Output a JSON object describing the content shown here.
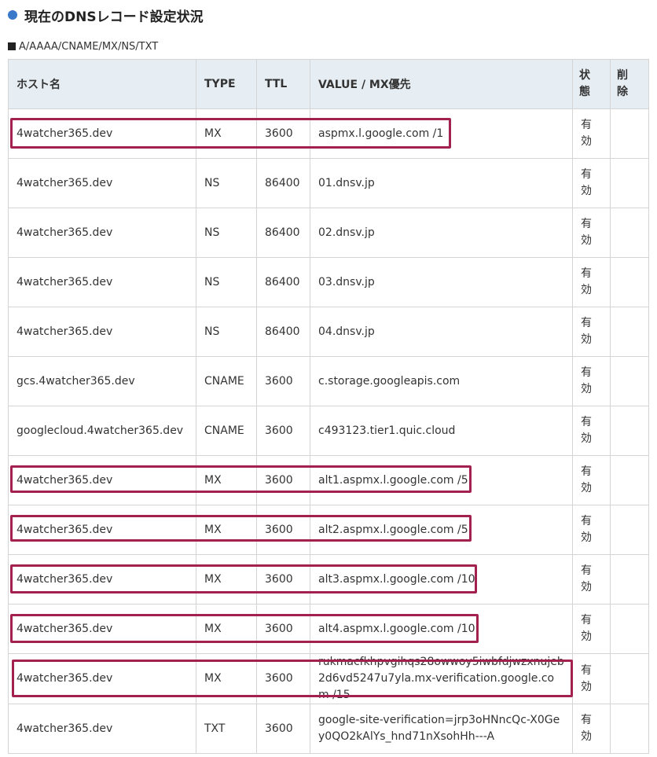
{
  "heading": {
    "text": "現在のDNSレコード設定状況",
    "dot_color": "#3a78c9"
  },
  "subheading": {
    "text": "A/AAAA/CNAME/MX/NS/TXT"
  },
  "table": {
    "headers": {
      "host": "ホスト名",
      "type": "TYPE",
      "ttl": "TTL",
      "value": "VALUE / MX優先",
      "status": "状態",
      "delete": "削除"
    },
    "rows": [
      {
        "host": "4watcher365.dev",
        "type": "MX",
        "ttl": "3600",
        "value": "aspmx.l.google.com /1",
        "status": "有効",
        "delete": ""
      },
      {
        "host": "4watcher365.dev",
        "type": "NS",
        "ttl": "86400",
        "value": "01.dnsv.jp",
        "status": "有効",
        "delete": ""
      },
      {
        "host": "4watcher365.dev",
        "type": "NS",
        "ttl": "86400",
        "value": "02.dnsv.jp",
        "status": "有効",
        "delete": ""
      },
      {
        "host": "4watcher365.dev",
        "type": "NS",
        "ttl": "86400",
        "value": "03.dnsv.jp",
        "status": "有効",
        "delete": ""
      },
      {
        "host": "4watcher365.dev",
        "type": "NS",
        "ttl": "86400",
        "value": "04.dnsv.jp",
        "status": "有効",
        "delete": ""
      },
      {
        "host": "gcs.4watcher365.dev",
        "type": "CNAME",
        "ttl": "3600",
        "value": "c.storage.googleapis.com",
        "status": "有効",
        "delete": ""
      },
      {
        "host": "googlecloud.4watcher365.dev",
        "type": "CNAME",
        "ttl": "3600",
        "value": "c493123.tier1.quic.cloud",
        "status": "有効",
        "delete": ""
      },
      {
        "host": "4watcher365.dev",
        "type": "MX",
        "ttl": "3600",
        "value": "alt1.aspmx.l.google.com /5",
        "status": "有効",
        "delete": ""
      },
      {
        "host": "4watcher365.dev",
        "type": "MX",
        "ttl": "3600",
        "value": "alt2.aspmx.l.google.com /5",
        "status": "有効",
        "delete": ""
      },
      {
        "host": "4watcher365.dev",
        "type": "MX",
        "ttl": "3600",
        "value": "alt3.aspmx.l.google.com /10",
        "status": "有効",
        "delete": ""
      },
      {
        "host": "4watcher365.dev",
        "type": "MX",
        "ttl": "3600",
        "value": "alt4.aspmx.l.google.com /10",
        "status": "有効",
        "delete": ""
      },
      {
        "host": "4watcher365.dev",
        "type": "MX",
        "ttl": "3600",
        "value": "rukmacfkhpvgihqs28owwoy5iwbfdjwzxnujeb2d6vd5247u7yla.mx-verification.google.com /15",
        "status": "有効",
        "delete": ""
      },
      {
        "host": "4watcher365.dev",
        "type": "TXT",
        "ttl": "3600",
        "value": "google-site-verification=jrp3oHNncQc-X0Gey0QO2kAlYs_hnd71nXsohHh---A",
        "status": "有効",
        "delete": ""
      }
    ]
  },
  "highlight_color": "#a3214f"
}
